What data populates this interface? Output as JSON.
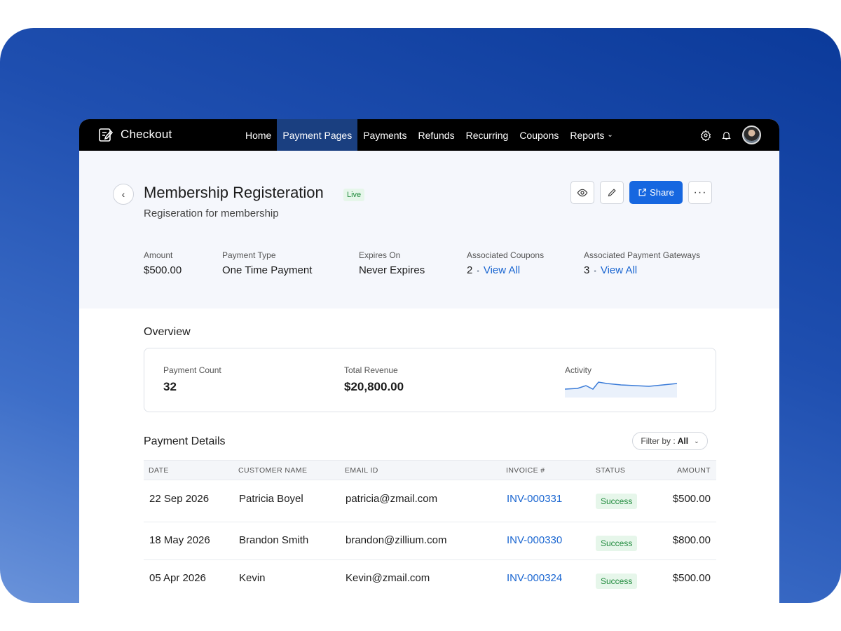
{
  "app": {
    "brand": "Checkout"
  },
  "nav": {
    "items": [
      "Home",
      "Payment Pages",
      "Payments",
      "Refunds",
      "Recurring",
      "Coupons",
      "Reports"
    ],
    "active": "Payment Pages"
  },
  "page": {
    "title": "Membership Registeration",
    "status": "Live",
    "subtitle": "Regiseration for membership",
    "share_label": "Share"
  },
  "meta": {
    "amount_label": "Amount",
    "amount": "$500.00",
    "type_label": "Payment Type",
    "type": "One Time Payment",
    "expires_label": "Expires On",
    "expires": "Never Expires",
    "coupons_label": "Associated Coupons",
    "coupons_count": "2",
    "coupons_link": "View All",
    "gateways_label": "Associated Payment Gateways",
    "gateways_count": "3",
    "gateways_link": "View All"
  },
  "overview": {
    "title": "Overview",
    "count_label": "Payment Count",
    "count": "32",
    "revenue_label": "Total Revenue",
    "revenue": "$20,800.00",
    "activity_label": "Activity"
  },
  "details": {
    "title": "Payment Details",
    "filter_label": "Filter by :",
    "filter_value": "All",
    "columns": [
      "DATE",
      "CUSTOMER NAME",
      "EMAIL ID",
      "INVOICE #",
      "STATUS",
      "AMOUNT"
    ],
    "rows": [
      {
        "date": "22 Sep 2026",
        "name": "Patricia Boyel",
        "email": "patricia@zmail.com",
        "invoice": "INV-000331",
        "status": "Success",
        "amount": "$500.00"
      },
      {
        "date": "18 May 2026",
        "name": "Brandon Smith",
        "email": "brandon@zillium.com",
        "invoice": "INV-000330",
        "status": "Success",
        "amount": "$800.00"
      },
      {
        "date": "05 Apr 2026",
        "name": "Kevin",
        "email": "Kevin@zmail.com",
        "invoice": "INV-000324",
        "status": "Success",
        "amount": "$500.00"
      }
    ]
  },
  "colors": {
    "accent": "#1667e0",
    "nav_active": "#1a3f80",
    "success_bg": "#e6f6ea",
    "success_text": "#1f8a3c"
  },
  "icons": [
    "checkout-logo-icon",
    "settings-icon",
    "bell-icon",
    "eye-icon",
    "edit-icon",
    "share-icon",
    "more-icon",
    "back-icon"
  ]
}
